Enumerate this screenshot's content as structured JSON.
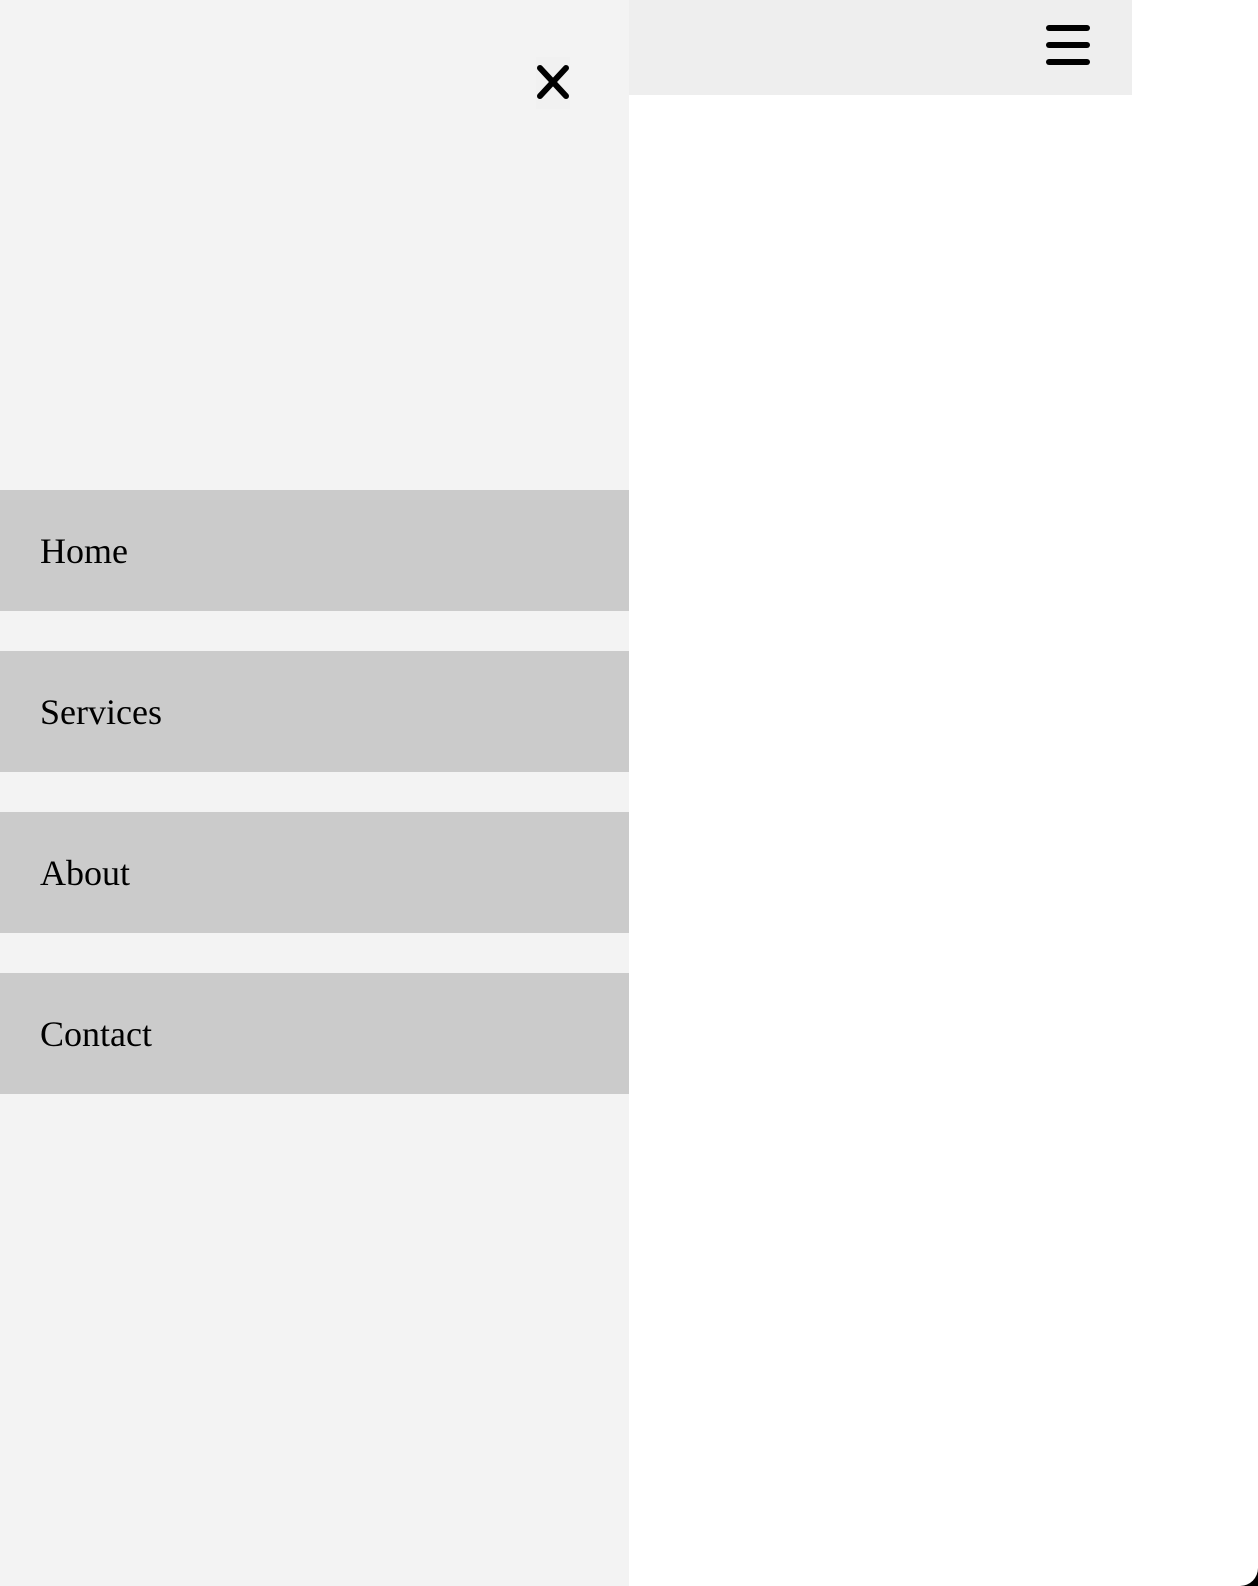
{
  "header": {
    "background": "#eeeeee",
    "menu_icon": "hamburger-menu-icon"
  },
  "drawer": {
    "background": "#f3f3f3",
    "close_icon": "close-icon",
    "items": [
      {
        "label": "Home"
      },
      {
        "label": "Services"
      },
      {
        "label": "About"
      },
      {
        "label": "Contact"
      }
    ],
    "item_background": "#cbcbcb"
  }
}
